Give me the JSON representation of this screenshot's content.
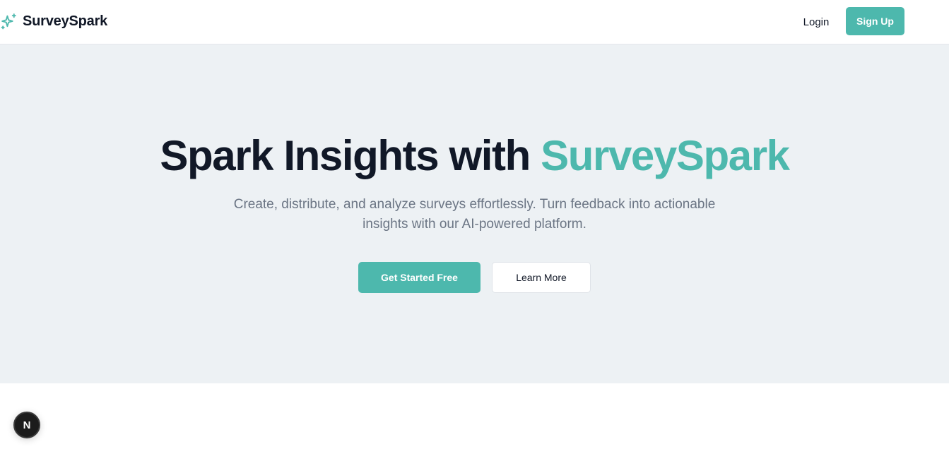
{
  "colors": {
    "accent": "#4db8ad",
    "heading": "#111827",
    "subtext": "#6b7584",
    "hero_bg": "#edf1f4",
    "badge_bg": "#1c1c1c"
  },
  "header": {
    "logo_icon": "sparkles-icon",
    "brand": "SurveySpark",
    "login_label": "Login",
    "signup_label": "Sign Up"
  },
  "hero": {
    "title_main": "Spark Insights with ",
    "title_accent": "SurveySpark",
    "subtitle": "Create, distribute, and analyze surveys effortlessly. Turn feedback into actionable insights with our AI-powered platform.",
    "primary_cta": "Get Started Free",
    "secondary_cta": "Learn More"
  },
  "dev_badge": {
    "icon": "nextjs-icon",
    "letter": "N"
  }
}
